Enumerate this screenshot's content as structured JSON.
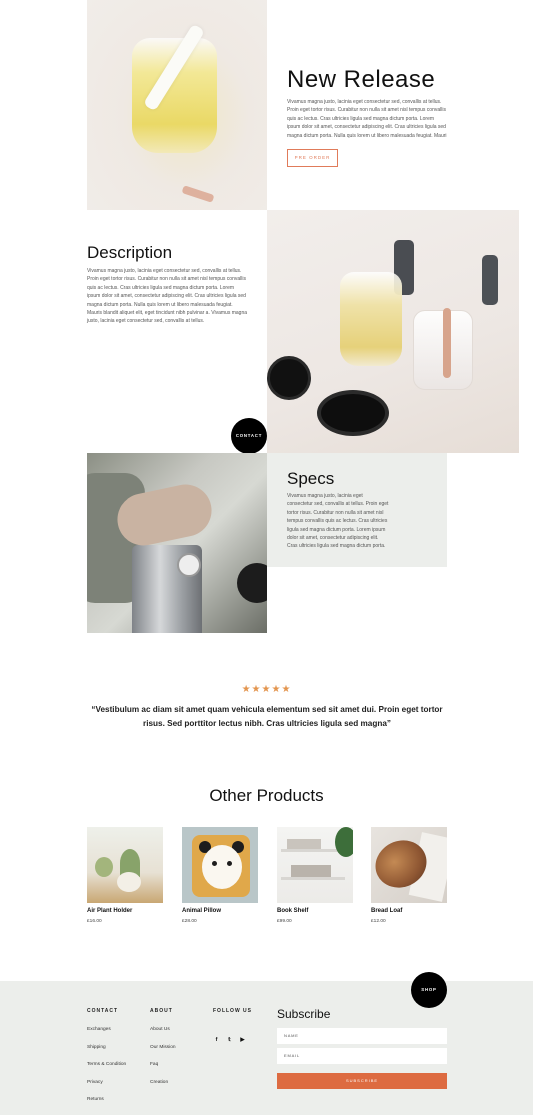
{
  "new_release": {
    "title": "New Release",
    "text": "Vivamus magna justo, lacinia eget consectetur sed, convallis at tellus. Proin eget tortor risus. Curabitur non nulla sit amet nisl tempus convallis quis ac lectus. Cras ultricies ligula sed magna dictum porta. Lorem ipsum dolor sit amet, consectetur adipiscing elit. Cras ultricies ligula sed magna dictum porta. Nulla quis lorem ut libero malesuada feugiat. Mauri",
    "button_label": "PRE ORDER"
  },
  "description": {
    "title": "Description",
    "text": "Vivamus magna justo, lacinia eget consectetur sed, convallis at tellus. Proin eget tortor risus. Curabitur non nulla sit amet nisl tempus convallis quis ac lectus. Cras ultricies ligula sed magna dictum porta. Lorem ipsum dolor sit amet, consectetur adipiscing elit. Cras ultricies ligula sed magna dictum porta. Nulla quis lorem ut libero malesuada feugiat. Mauris blandit aliquet elit, eget tincidunt nibh pulvinar a. Vivamus magna justo, lacinia eget consectetur sed, convallis at tellus."
  },
  "contact_button": "CONTACT",
  "specs": {
    "title": "Specs",
    "text": "Vivamus magna justo, lacinia eget consectetur sed, convallis at tellus. Proin eget tortor risus. Curabitur non nulla sit amet nisl tempus convallis quis ac lectus. Cras ultricies ligula sed magna dictum porta. Lorem ipsum dolor sit amet, consectetur adipiscing elit. Cras ultricies ligula sed magna dictum porta."
  },
  "testimonial": {
    "stars": "★★★★★",
    "rating": 5,
    "quote": "“Vestibulum ac diam sit amet quam vehicula elementum sed sit amet dui. Proin eget tortor risus. Sed porttitor lectus nibh. Cras ultricies ligula sed magna”"
  },
  "other_products": {
    "title": "Other Products",
    "items": [
      {
        "name": "Air Plant Holder",
        "price": "£16.00"
      },
      {
        "name": "Animal Pillow",
        "price": "£28.00"
      },
      {
        "name": "Book Shelf",
        "price": "£99.00"
      },
      {
        "name": "Bread Loaf",
        "price": "£12.00"
      }
    ]
  },
  "shop_button": "SHOP",
  "footer": {
    "contact": {
      "heading": "CONTACT",
      "links": [
        "Exchanges",
        "Shipping",
        "Terms & Condition",
        "Privacy",
        "Returns"
      ]
    },
    "about": {
      "heading": "ABOUT",
      "links": [
        "About Us",
        "Our Mission",
        "Faq",
        "Creation"
      ]
    },
    "follow": {
      "heading": "FOLLOW US",
      "icons": [
        "facebook-icon",
        "twitter-icon",
        "youtube-icon"
      ],
      "glyphs": [
        "f",
        "𝕥",
        "▶"
      ]
    },
    "subscribe": {
      "title": "Subscribe",
      "name_placeholder": "NAME",
      "email_placeholder": "EMAIL",
      "button_label": "SUBSCRIBE"
    }
  },
  "colors": {
    "accent": "#dd6b41",
    "stars": "#e3954f",
    "panel": "#eceeeb"
  }
}
